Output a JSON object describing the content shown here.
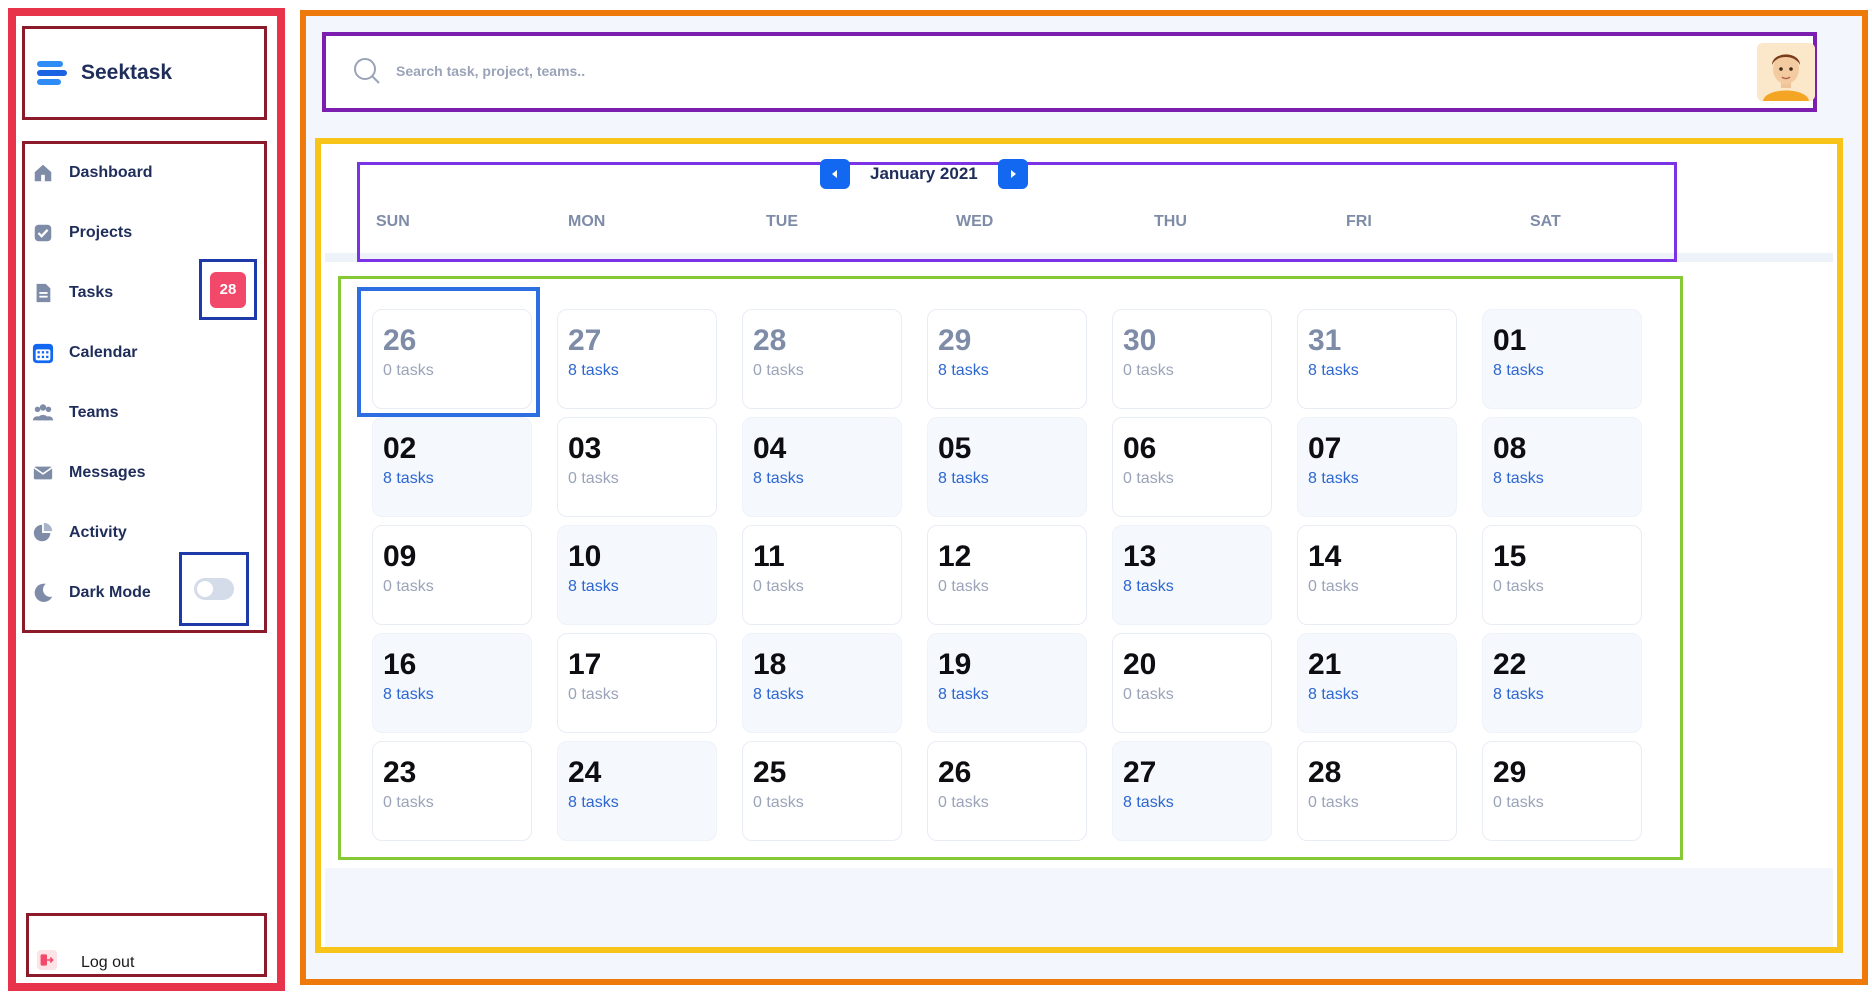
{
  "app": {
    "name": "Seektask"
  },
  "sidebar": {
    "items": [
      {
        "label": "Dashboard",
        "icon": "home-icon"
      },
      {
        "label": "Projects",
        "icon": "checkbox-icon"
      },
      {
        "label": "Tasks",
        "icon": "document-icon",
        "badge": "28"
      },
      {
        "label": "Calendar",
        "icon": "calendar-icon"
      },
      {
        "label": "Teams",
        "icon": "team-icon"
      },
      {
        "label": "Messages",
        "icon": "envelope-icon"
      },
      {
        "label": "Activity",
        "icon": "pie-chart-icon"
      },
      {
        "label": "Dark Mode",
        "icon": "moon-icon",
        "toggle": false
      }
    ],
    "logout_label": "Log out"
  },
  "search": {
    "placeholder": "Search task, project, teams.."
  },
  "calendar": {
    "month_label": "January 2021",
    "weekdays": [
      "SUN",
      "MON",
      "TUE",
      "WED",
      "THU",
      "FRI",
      "SAT"
    ],
    "days": [
      {
        "num": "26",
        "tasks": "0 tasks"
      },
      {
        "num": "27",
        "tasks": "8 tasks"
      },
      {
        "num": "28",
        "tasks": "0 tasks"
      },
      {
        "num": "29",
        "tasks": "8 tasks"
      },
      {
        "num": "30",
        "tasks": "0 tasks"
      },
      {
        "num": "31",
        "tasks": "8 tasks"
      },
      {
        "num": "01",
        "tasks": "8 tasks"
      },
      {
        "num": "02",
        "tasks": "8 tasks"
      },
      {
        "num": "03",
        "tasks": "0 tasks"
      },
      {
        "num": "04",
        "tasks": "8 tasks"
      },
      {
        "num": "05",
        "tasks": "8 tasks"
      },
      {
        "num": "06",
        "tasks": "0 tasks"
      },
      {
        "num": "07",
        "tasks": "8 tasks"
      },
      {
        "num": "08",
        "tasks": "8 tasks"
      },
      {
        "num": "09",
        "tasks": "0 tasks"
      },
      {
        "num": "10",
        "tasks": "8 tasks"
      },
      {
        "num": "11",
        "tasks": "0 tasks"
      },
      {
        "num": "12",
        "tasks": "0 tasks"
      },
      {
        "num": "13",
        "tasks": "8 tasks"
      },
      {
        "num": "14",
        "tasks": "0 tasks"
      },
      {
        "num": "15",
        "tasks": "0 tasks"
      },
      {
        "num": "16",
        "tasks": "8 tasks"
      },
      {
        "num": "17",
        "tasks": "0 tasks"
      },
      {
        "num": "18",
        "tasks": "8 tasks"
      },
      {
        "num": "19",
        "tasks": "8 tasks"
      },
      {
        "num": "20",
        "tasks": "0 tasks"
      },
      {
        "num": "21",
        "tasks": "8 tasks"
      },
      {
        "num": "22",
        "tasks": "8 tasks"
      },
      {
        "num": "23",
        "tasks": "0 tasks"
      },
      {
        "num": "24",
        "tasks": "8 tasks"
      },
      {
        "num": "25",
        "tasks": "0 tasks"
      },
      {
        "num": "26",
        "tasks": "0 tasks"
      },
      {
        "num": "27",
        "tasks": "8 tasks"
      },
      {
        "num": "28",
        "tasks": "0 tasks"
      },
      {
        "num": "29",
        "tasks": "0 tasks"
      }
    ],
    "faded_count": 6
  },
  "colors": {
    "accent": "#1268f0",
    "badge": "#f2486a",
    "task_link": "#2d67cf"
  }
}
